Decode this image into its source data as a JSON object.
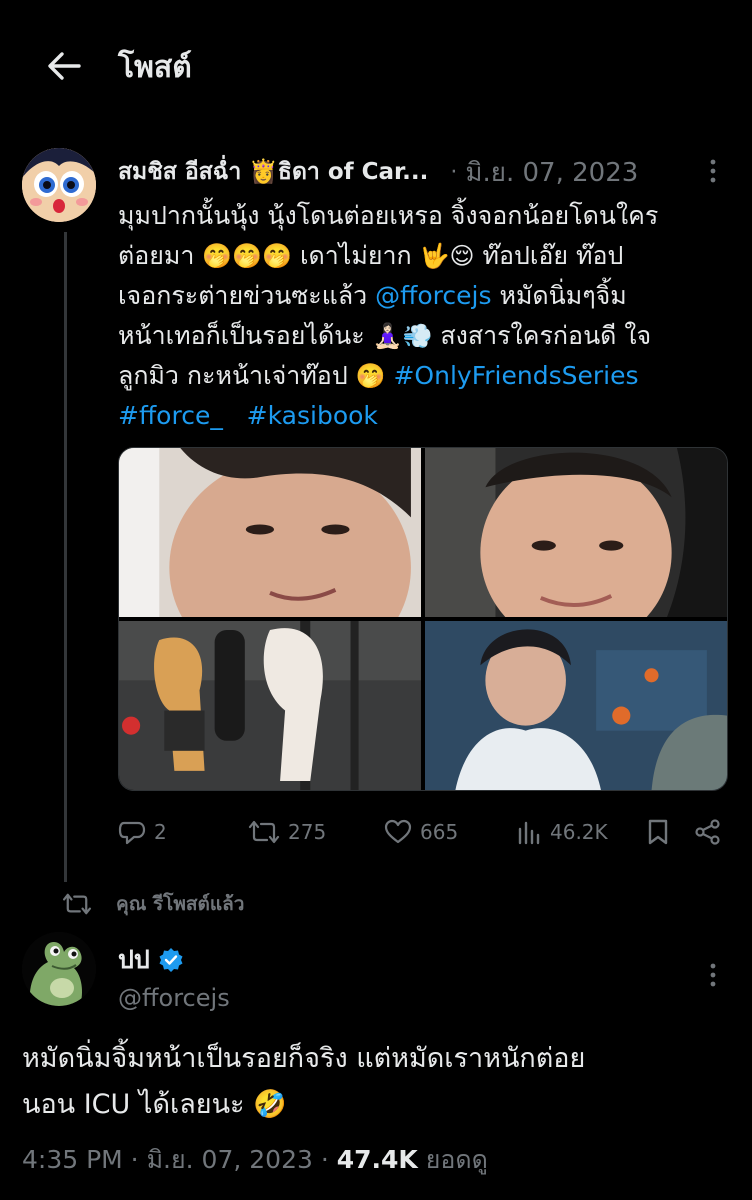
{
  "header": {
    "title": "โพสต์"
  },
  "tweet1": {
    "name": "สมชิส อีสฉ่ำ 👸ธิดา of Car...",
    "date": "มิ.ย. 07, 2023",
    "text_parts": [
      "มุมปากนั้นนุ้ง นุ้งโดนต่อยเหรอ จิ้งจอกน้อยโดนใคร\nต่อยมา ",
      "🤭🤭🤭",
      " เดาไม่ยาก ",
      "🤟😌",
      " ท๊อปเอ๊ย ท๊อป\nเจอกระต่ายข่วนซะแล้ว ",
      " หมัดนิ่มๆจิ้ม\nหน้าเทอก็เป็นรอยได้นะ ",
      "🧘🏻‍♀️💨",
      " สงสารใครก่อนดี ใจ\nลูกมิว กะหน้าเจ่าท๊อป ",
      "🤭",
      " "
    ],
    "mention": "@fforcejs",
    "hashtags": [
      "#OnlyFriendsSeries",
      "#fforce_",
      "#kasibook"
    ],
    "media": [
      "close-up-smile-photo",
      "car-selfie-photo",
      "boxing-scene-photo",
      "classroom-scene-photo"
    ],
    "stats": {
      "replies": "2",
      "reposts": "275",
      "likes": "665",
      "views": "46.2K"
    }
  },
  "repost_label": "คุณ รีโพสต์แล้ว",
  "tweet2": {
    "name": "ปป",
    "handle": "@fforcejs",
    "text": "หมัดนิ่มจิ้มหน้าเป็นรอยก็จริง แต่หมัดเราหนักต่อย\nนอน ICU ได้เลยนะ ",
    "emoji": "🤣",
    "time": "4:35 PM",
    "sep": " · ",
    "date": "มิ.ย. 07, 2023",
    "views": "47.4K",
    "views_label": " ยอดดู"
  },
  "colors": {
    "accent": "#1d9bf0",
    "muted": "#71767b",
    "text": "#e7e9ea",
    "bg": "#000000"
  }
}
